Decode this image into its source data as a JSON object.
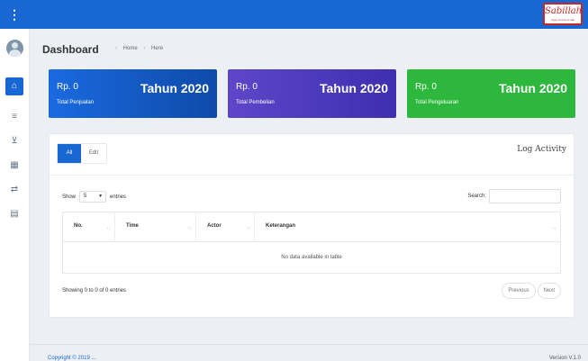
{
  "topbar": {
    "menu_icon": "⋮",
    "logo_text": "Sabillah",
    "logo_sub": "Agen Umroh & Haji"
  },
  "sidebar": {
    "items": [
      {
        "name": "home",
        "icon": "⌂",
        "active": true
      },
      {
        "name": "database",
        "icon": "≡"
      },
      {
        "name": "cart",
        "icon": "⊻"
      },
      {
        "name": "calendar",
        "icon": "▦"
      },
      {
        "name": "transfer",
        "icon": "⇄"
      },
      {
        "name": "report",
        "icon": "▤"
      }
    ]
  },
  "header": {
    "title": "Dashboard",
    "breadcrumb": [
      "Home",
      "Here"
    ]
  },
  "cards": [
    {
      "amount": "Rp. 0",
      "year": "Tahun 2020",
      "caption": "Total Penjualan",
      "color": "#1a6ae0"
    },
    {
      "amount": "Rp. 0",
      "year": "Tahun 2020",
      "caption": "Total Pembelian",
      "color": "#5e46c8"
    },
    {
      "amount": "Rp. 0",
      "year": "Tahun 2020",
      "caption": "Total Pengeluaran",
      "color": "#2db83d"
    }
  ],
  "panel": {
    "title": "Log Activity",
    "tabs": [
      "All",
      "Edit"
    ],
    "show_label": "Show",
    "entries_value": "5",
    "entries_label": "entries",
    "search_label": "Search:",
    "search_placeholder": "",
    "columns": [
      "No.",
      "Time",
      "Actor",
      "Keterangan"
    ],
    "empty_text": "No data available in table",
    "info_text": "Showing 0 to 0 of 0 entries",
    "prev_label": "Previous",
    "next_label": "Next"
  },
  "footer": {
    "left": "Copyright © 2019 ...",
    "right": "Version V.1.0"
  },
  "colors": {
    "primary": "#1967d2",
    "purple": "#5e46c8",
    "green": "#2db83d"
  }
}
